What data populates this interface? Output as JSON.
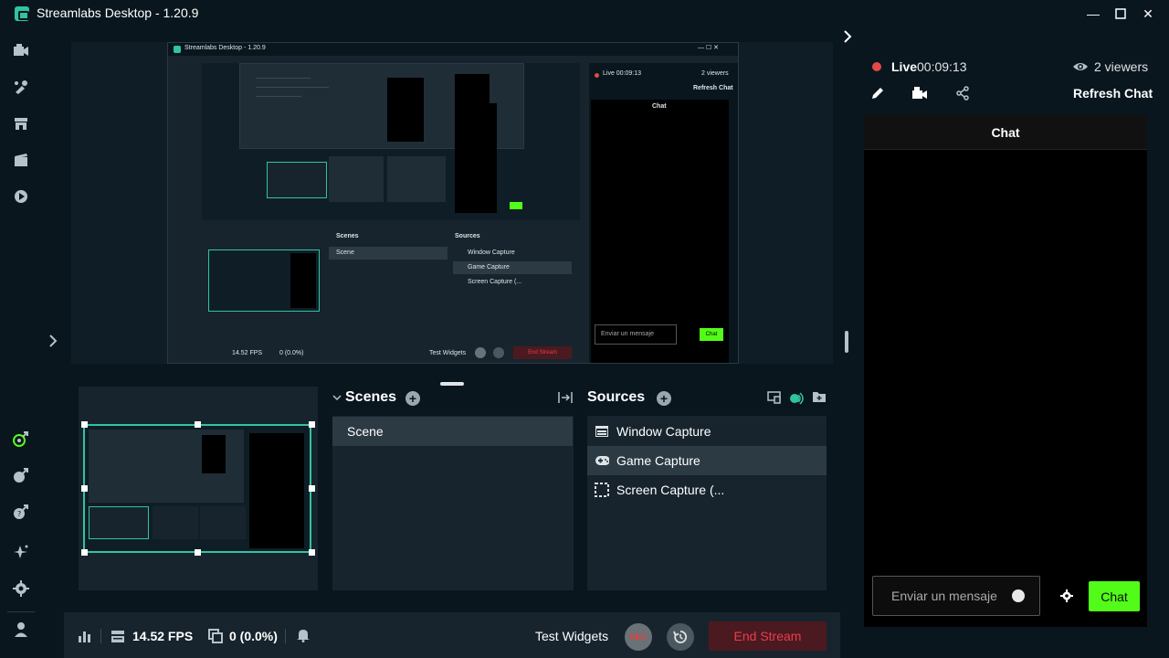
{
  "window": {
    "title": "Streamlabs Desktop - 1.20.9",
    "minimize": "—",
    "maximize": "☐",
    "close": "✕"
  },
  "nav": {
    "items": [
      "editor-icon",
      "themes-icon",
      "store-icon",
      "recordings-icon",
      "play-icon"
    ],
    "bottom_items": [
      "alert-box-icon",
      "widget-icon",
      "help-icon",
      "highlighter-icon",
      "settings-icon",
      "user-icon"
    ]
  },
  "scenes": {
    "title": "Scenes",
    "items": [
      "Scene"
    ]
  },
  "sources": {
    "title": "Sources",
    "items": [
      {
        "label": "Window Capture",
        "icon": "window-icon"
      },
      {
        "label": "Game Capture",
        "icon": "gamepad-icon"
      },
      {
        "label": "Screen Capture (...",
        "icon": "screen-capture-icon"
      }
    ]
  },
  "footer": {
    "fps": "14.52 FPS",
    "dropped": "0 (0.0%)",
    "test_widgets": "Test Widgets",
    "rec_label": "REC",
    "end_stream": "End Stream"
  },
  "live": {
    "status": "Live",
    "time": "00:09:13",
    "viewers": "2 viewers",
    "refresh": "Refresh Chat"
  },
  "chat": {
    "title": "Chat",
    "placeholder": "Enviar un mensaje",
    "send": "Chat"
  },
  "nested": {
    "title": "Streamlabs Desktop - 1.20.9",
    "live": "Live 00:09:13",
    "viewers": "2 viewers",
    "refresh": "Refresh Chat",
    "chat": "Chat",
    "scenes": "Scenes",
    "sources": "Sources",
    "scene": "Scene",
    "source1": "Window Capture",
    "source2": "Game Capture",
    "source3": "Screen Capture (...",
    "fps": "14.52 FPS",
    "dropped": "0 (0.0%)",
    "test_widgets": "Test Widgets",
    "end_stream": "End Stream",
    "placeholder": "Enviar un mensaje",
    "send": "Chat"
  },
  "colors": {
    "background": "#09161d",
    "panel": "#17242d",
    "accent": "#31c3a2",
    "kick_green": "#53fc18",
    "danger": "#ea3c4e"
  }
}
